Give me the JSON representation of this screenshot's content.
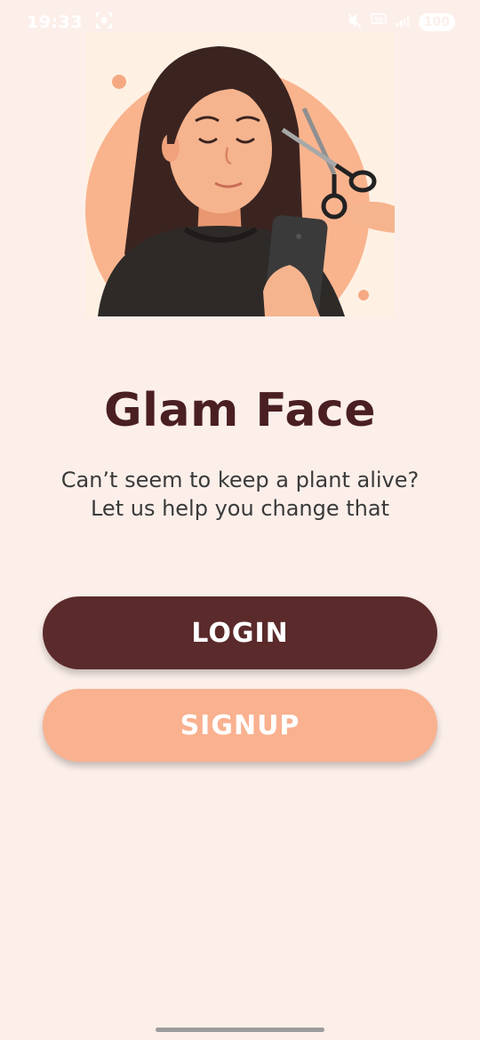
{
  "status_bar": {
    "time": "19:33",
    "battery": "100",
    "network": "5G",
    "icons": [
      "screen-record-icon",
      "mute-icon",
      "network-5g-icon",
      "signal-icon",
      "battery-icon"
    ]
  },
  "illustration": {
    "description_icon": "woman-haircut-illustration"
  },
  "app": {
    "title": "Glam Face",
    "tagline_line1": "Can’t seem to keep a plant alive?",
    "tagline_line2": "Let us help you change that"
  },
  "buttons": {
    "login_label": "LOGIN",
    "signup_label": "SIGNUP"
  },
  "colors": {
    "background": "#FCEFEA",
    "title": "#4A1F22",
    "login_button": "#5B2A2B",
    "signup_button": "#F9B18F"
  }
}
